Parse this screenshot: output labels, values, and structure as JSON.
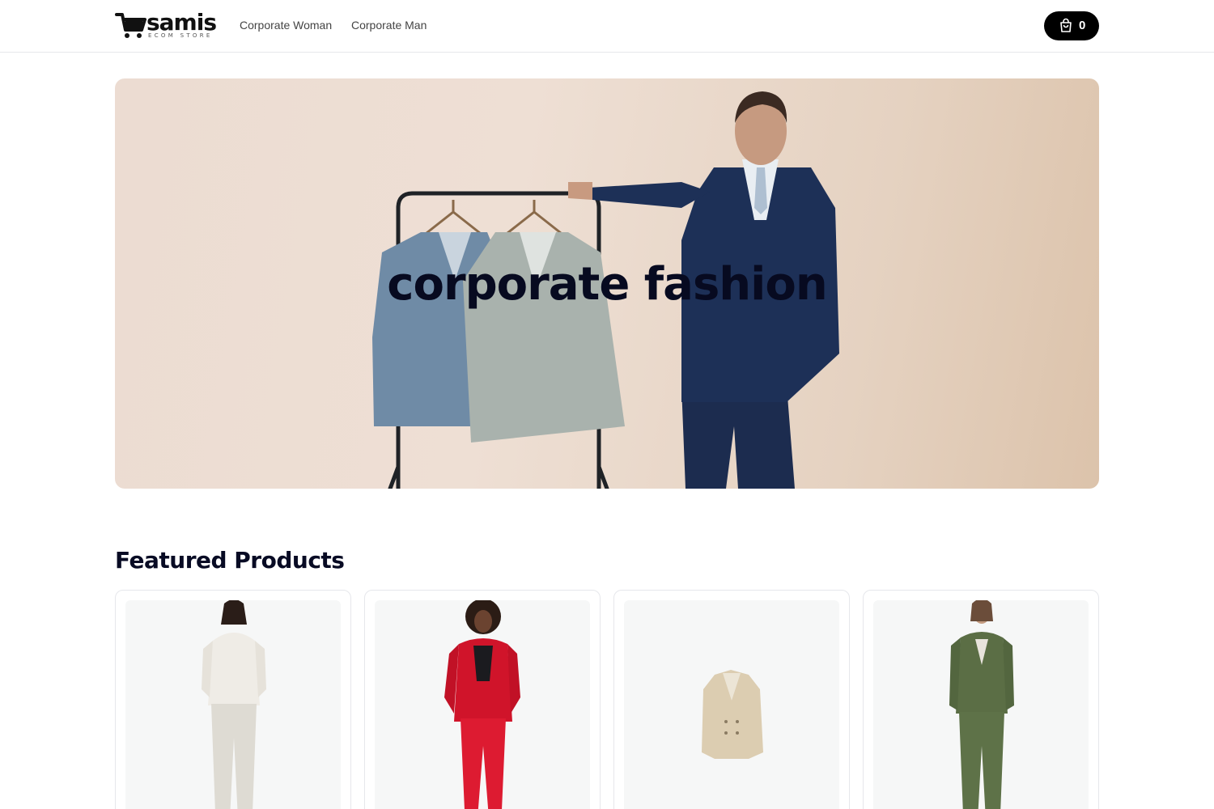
{
  "brand": {
    "name": "samis",
    "tagline": "ECOM STORE"
  },
  "nav": {
    "items": [
      {
        "label": "Corporate Woman"
      },
      {
        "label": "Corporate Man"
      }
    ]
  },
  "cart": {
    "count": "0",
    "icon": "shopping-bag-icon"
  },
  "hero": {
    "title": "corporate fashion"
  },
  "featured": {
    "title": "Featured Products",
    "products": [
      {
        "image": "woman-white-suit"
      },
      {
        "image": "woman-red-suit"
      },
      {
        "image": "beige-blazer"
      },
      {
        "image": "woman-green-suit"
      }
    ]
  },
  "colors": {
    "accent": "#000000",
    "text": "#0b0d1c",
    "border": "#e6e7eb",
    "card_bg": "#f6f7f7"
  }
}
